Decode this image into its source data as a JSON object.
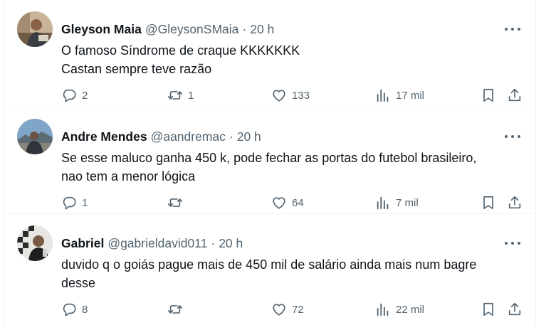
{
  "tweets": [
    {
      "name": "Gleyson Maia",
      "handle": "@GleysonSMaia",
      "separator": "·",
      "time": "20 h",
      "avatar": "avatar-photo",
      "lines": [
        "O famoso Síndrome de craque KKKKKKK",
        "Castan sempre teve razão"
      ],
      "replies": "2",
      "reposts": "1",
      "likes": "133",
      "views": "17 mil"
    },
    {
      "name": "Andre Mendes",
      "handle": "@aandremac",
      "separator": "·",
      "time": "20 h",
      "avatar": "avatar-photo",
      "lines": [
        "Se esse maluco ganha 450 k, pode fechar as portas do futebol brasileiro,",
        "nao tem a menor lógica"
      ],
      "replies": "1",
      "reposts": "",
      "likes": "64",
      "views": "7 mil"
    },
    {
      "name": "Gabriel",
      "handle": "@gabrieldavid011",
      "separator": "·",
      "time": "20 h",
      "avatar": "avatar-photo",
      "lines": [
        "duvido q o goiás pague mais de 450 mil de salário ainda mais num bagre",
        "desse"
      ],
      "replies": "8",
      "reposts": "",
      "likes": "72",
      "views": "22 mil"
    }
  ],
  "icons": {
    "more": "more-horizontal-icon",
    "reply": "reply-icon",
    "repost": "repost-icon",
    "like": "heart-icon",
    "views": "views-chart-icon",
    "bookmark": "bookmark-icon",
    "share": "share-icon"
  },
  "colors": {
    "text": "#0f1419",
    "secondary": "#536471",
    "border": "#eff3f4"
  }
}
